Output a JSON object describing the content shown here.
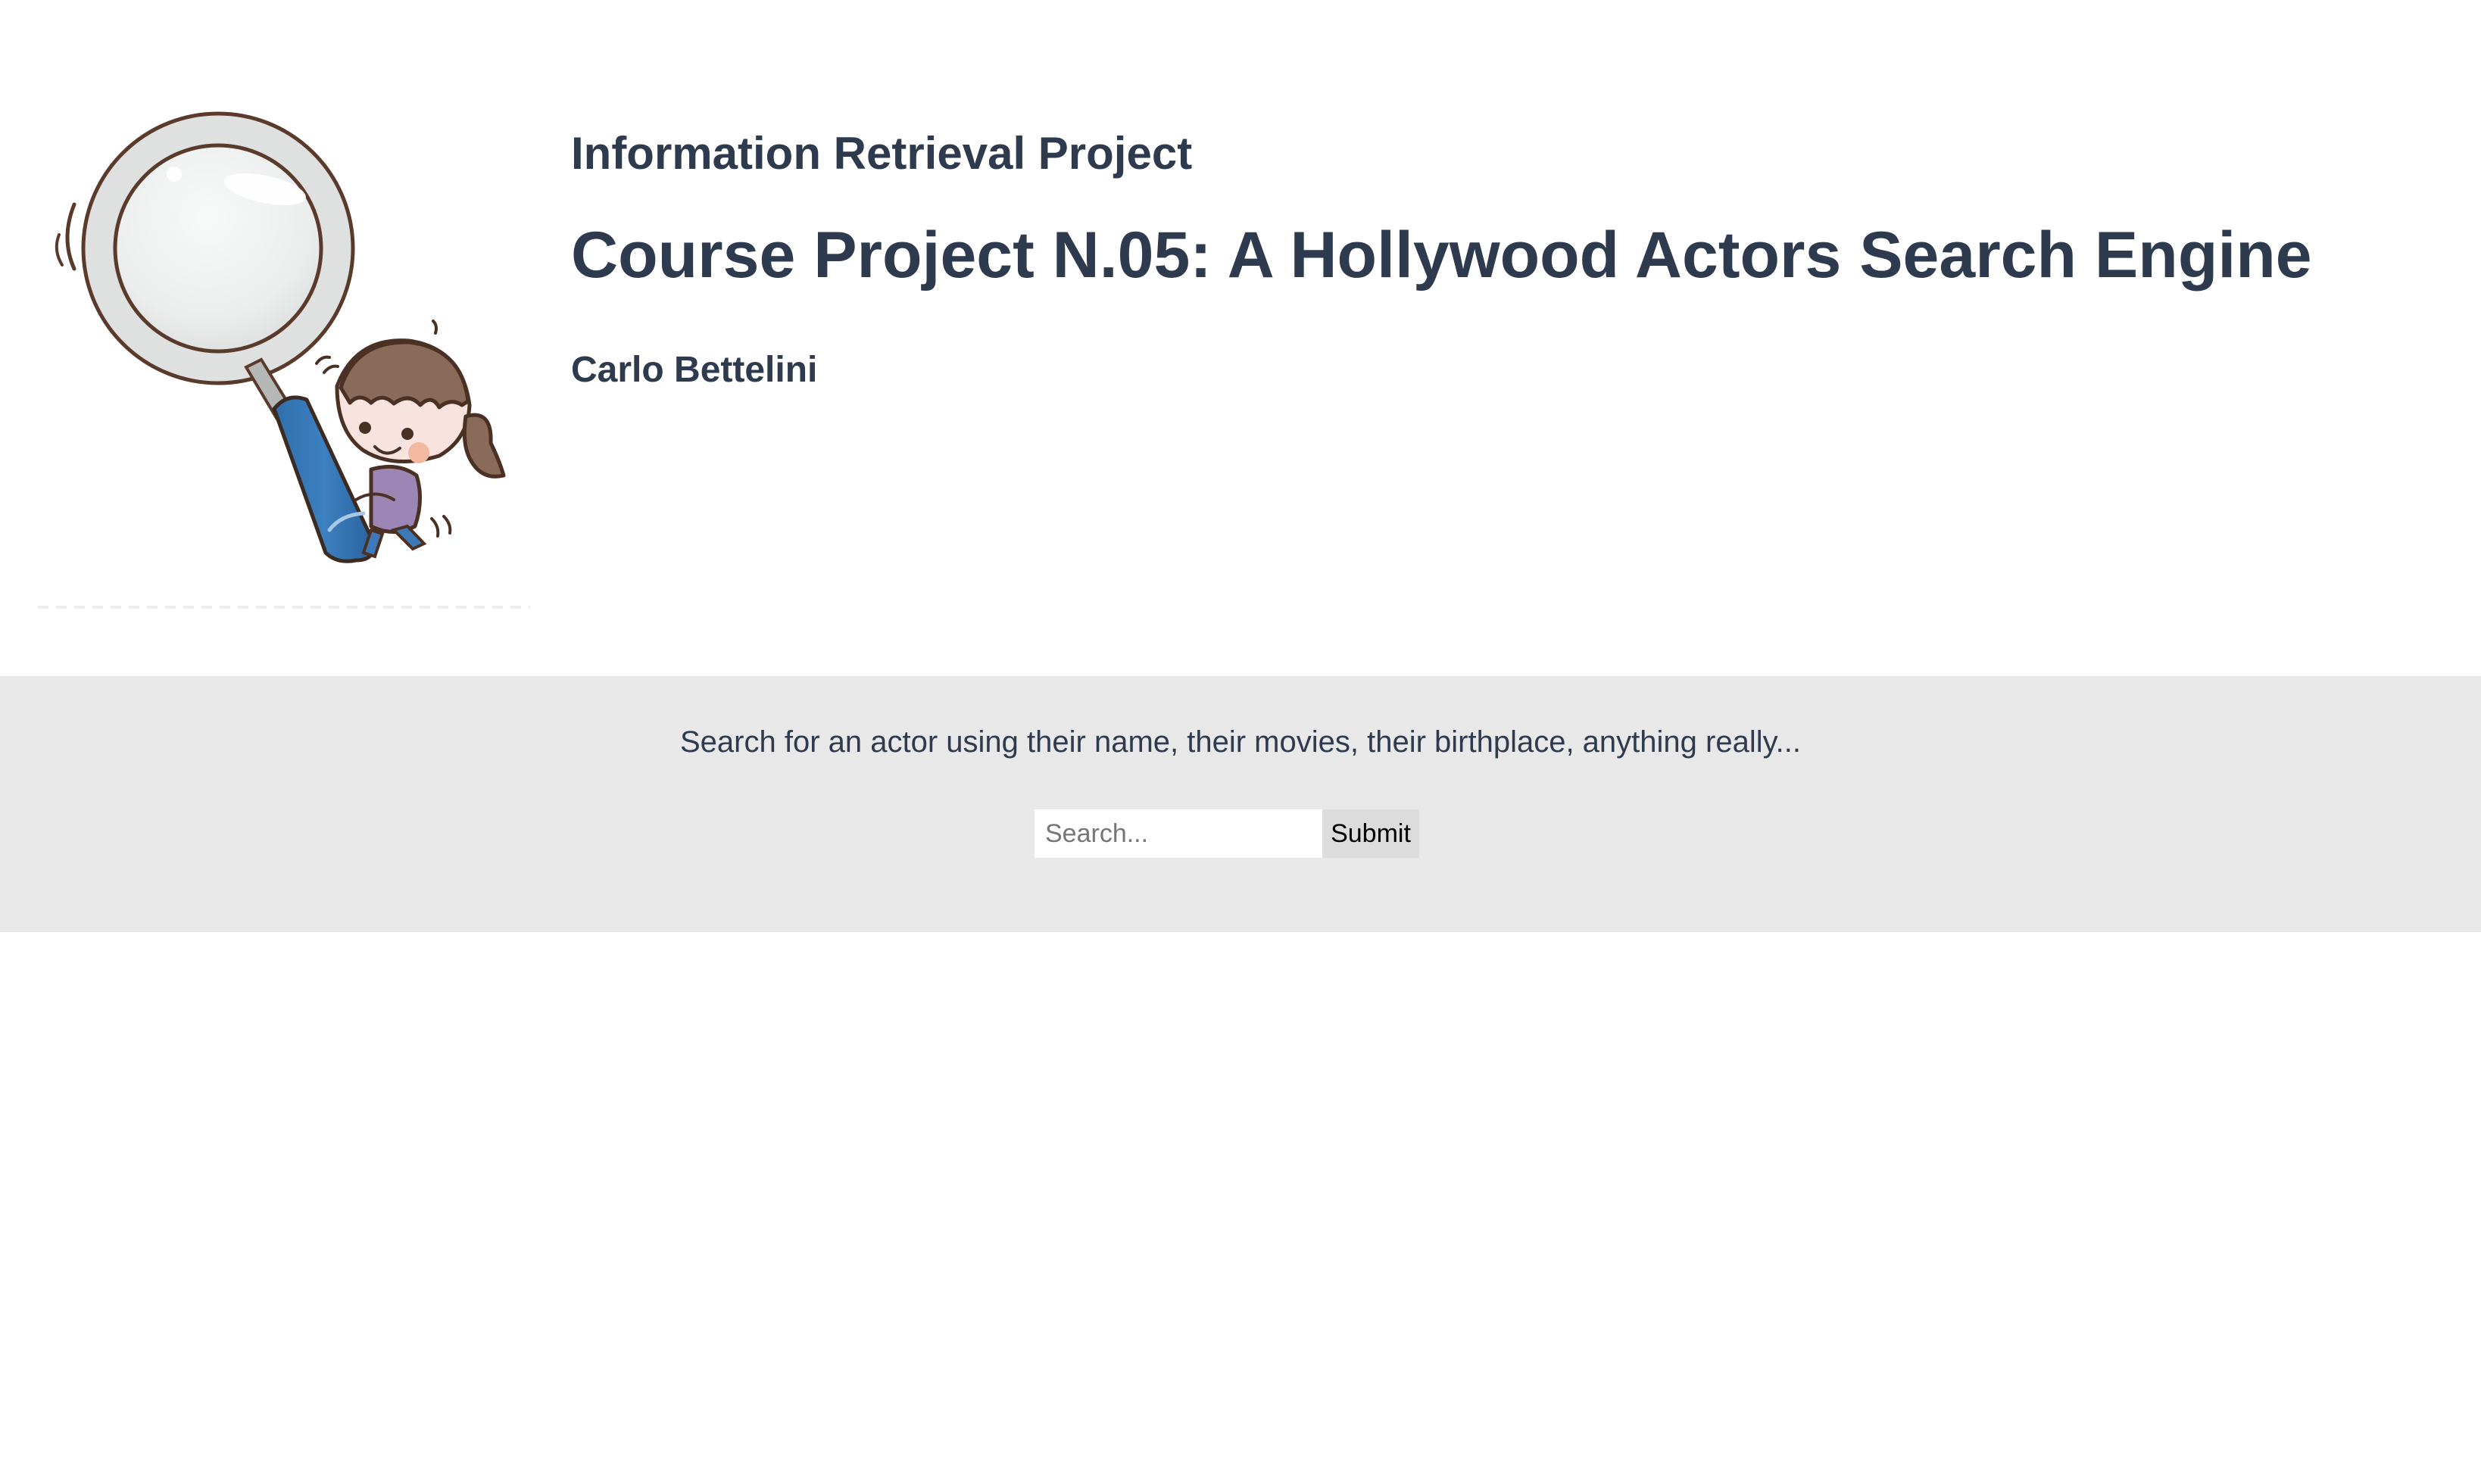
{
  "header": {
    "logo_icon": "magnifier-girl-illustration",
    "kicker": "Information Retrieval Project",
    "title": "Course Project N.05: A Hollywood Actors Search Engine",
    "author": "Carlo Bettelini"
  },
  "search": {
    "prompt": "Search for an actor using their name, their movies, their birthplace, anything really...",
    "placeholder": "Search...",
    "value": "",
    "submit_label": "Submit"
  },
  "colors": {
    "text": "#2e3a4d",
    "band_background": "#e8e8e8",
    "submit_background": "#dcdcdc",
    "page_background": "#ffffff"
  }
}
